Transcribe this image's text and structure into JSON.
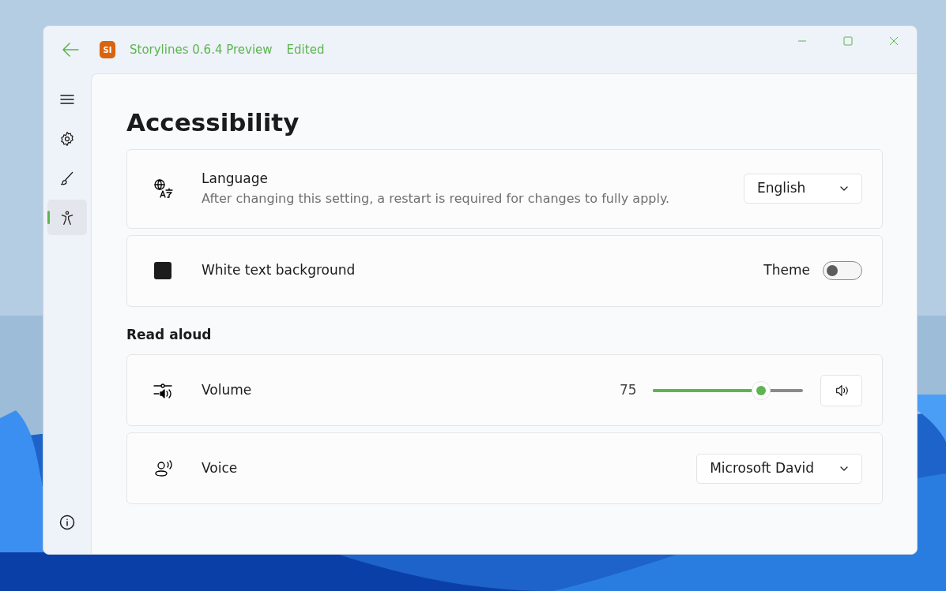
{
  "window": {
    "app_badge": "SI",
    "title": "Storylines 0.6.4 Preview",
    "status": "Edited"
  },
  "sidebar": {
    "items": [
      {
        "kind": "menu",
        "selected": false
      },
      {
        "kind": "settings",
        "selected": false
      },
      {
        "kind": "brush",
        "selected": false
      },
      {
        "kind": "accessibility",
        "selected": true
      }
    ]
  },
  "page": {
    "title": "Accessibility",
    "cards": [
      {
        "kind": "dropdown",
        "label": "Language",
        "description": "After changing this setting, a restart is required for changes to fully apply.",
        "value": "English"
      },
      {
        "kind": "toggle",
        "label": "White text background",
        "toggle_label": "Theme",
        "on": false
      }
    ],
    "section": "Read aloud",
    "aloud_cards": [
      {
        "kind": "slider",
        "label": "Volume",
        "reading": "75",
        "level": 0.72
      },
      {
        "kind": "dropdown",
        "label": "Voice",
        "value": "Microsoft David"
      }
    ]
  }
}
